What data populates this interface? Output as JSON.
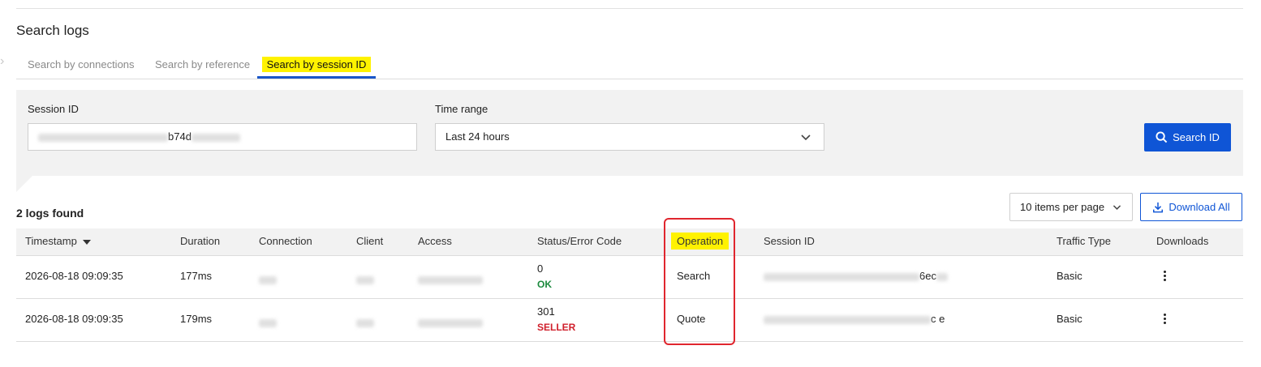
{
  "page": {
    "title": "Search logs"
  },
  "tabs": [
    {
      "label": "Search by connections",
      "active": false
    },
    {
      "label": "Search by reference",
      "active": false
    },
    {
      "label": "Search by session ID",
      "active": true
    }
  ],
  "form": {
    "session_id": {
      "label": "Session ID",
      "value_visible": "b74d"
    },
    "time_range": {
      "label": "Time range",
      "value": "Last 24 hours"
    },
    "search_button": {
      "label": "Search ID",
      "icon": "search-icon"
    }
  },
  "results": {
    "count_text": "2 logs found",
    "per_page": "10 items per page",
    "download_all": {
      "label": "Download All",
      "icon": "download-icon"
    }
  },
  "table": {
    "columns": [
      "Timestamp",
      "Duration",
      "Connection",
      "Client",
      "Access",
      "Status/Error Code",
      "Operation",
      "Session ID",
      "Traffic Type",
      "Downloads"
    ],
    "sort_column": "Timestamp",
    "sort_direction": "descending",
    "rows": [
      {
        "timestamp": "2026-08-18 09:09:35",
        "duration": "177ms",
        "status_code": "0",
        "status_text": "OK",
        "status_color": "#1c8a3e",
        "operation": "Search",
        "session_id_visible": "6ec",
        "traffic_type": "Basic"
      },
      {
        "timestamp": "2026-08-18 09:09:35",
        "duration": "179ms",
        "status_code": "301",
        "status_text": "SELLER",
        "status_color": "#d0202c",
        "operation": "Quote",
        "session_id_visible": "c  e",
        "traffic_type": "Basic"
      }
    ]
  },
  "colors": {
    "accent": "#0f55d6",
    "highlight": "#fff200",
    "annotation": "#e0262e",
    "panel_bg": "#f2f2f2"
  }
}
